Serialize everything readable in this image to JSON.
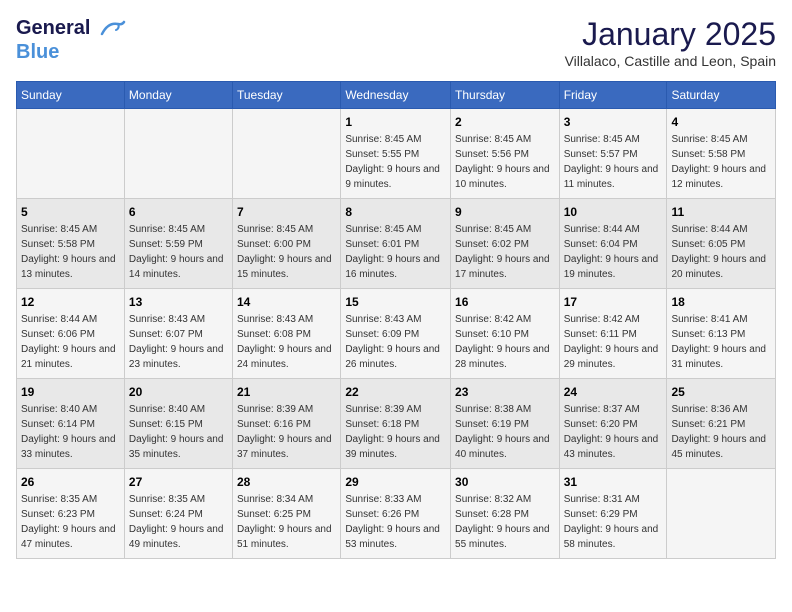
{
  "header": {
    "logo_line1": "General",
    "logo_line2": "Blue",
    "month": "January 2025",
    "location": "Villalaco, Castille and Leon, Spain"
  },
  "weekdays": [
    "Sunday",
    "Monday",
    "Tuesday",
    "Wednesday",
    "Thursday",
    "Friday",
    "Saturday"
  ],
  "weeks": [
    [
      {
        "day": "",
        "info": ""
      },
      {
        "day": "",
        "info": ""
      },
      {
        "day": "",
        "info": ""
      },
      {
        "day": "1",
        "info": "Sunrise: 8:45 AM\nSunset: 5:55 PM\nDaylight: 9 hours and 9 minutes."
      },
      {
        "day": "2",
        "info": "Sunrise: 8:45 AM\nSunset: 5:56 PM\nDaylight: 9 hours and 10 minutes."
      },
      {
        "day": "3",
        "info": "Sunrise: 8:45 AM\nSunset: 5:57 PM\nDaylight: 9 hours and 11 minutes."
      },
      {
        "day": "4",
        "info": "Sunrise: 8:45 AM\nSunset: 5:58 PM\nDaylight: 9 hours and 12 minutes."
      }
    ],
    [
      {
        "day": "5",
        "info": "Sunrise: 8:45 AM\nSunset: 5:58 PM\nDaylight: 9 hours and 13 minutes."
      },
      {
        "day": "6",
        "info": "Sunrise: 8:45 AM\nSunset: 5:59 PM\nDaylight: 9 hours and 14 minutes."
      },
      {
        "day": "7",
        "info": "Sunrise: 8:45 AM\nSunset: 6:00 PM\nDaylight: 9 hours and 15 minutes."
      },
      {
        "day": "8",
        "info": "Sunrise: 8:45 AM\nSunset: 6:01 PM\nDaylight: 9 hours and 16 minutes."
      },
      {
        "day": "9",
        "info": "Sunrise: 8:45 AM\nSunset: 6:02 PM\nDaylight: 9 hours and 17 minutes."
      },
      {
        "day": "10",
        "info": "Sunrise: 8:44 AM\nSunset: 6:04 PM\nDaylight: 9 hours and 19 minutes."
      },
      {
        "day": "11",
        "info": "Sunrise: 8:44 AM\nSunset: 6:05 PM\nDaylight: 9 hours and 20 minutes."
      }
    ],
    [
      {
        "day": "12",
        "info": "Sunrise: 8:44 AM\nSunset: 6:06 PM\nDaylight: 9 hours and 21 minutes."
      },
      {
        "day": "13",
        "info": "Sunrise: 8:43 AM\nSunset: 6:07 PM\nDaylight: 9 hours and 23 minutes."
      },
      {
        "day": "14",
        "info": "Sunrise: 8:43 AM\nSunset: 6:08 PM\nDaylight: 9 hours and 24 minutes."
      },
      {
        "day": "15",
        "info": "Sunrise: 8:43 AM\nSunset: 6:09 PM\nDaylight: 9 hours and 26 minutes."
      },
      {
        "day": "16",
        "info": "Sunrise: 8:42 AM\nSunset: 6:10 PM\nDaylight: 9 hours and 28 minutes."
      },
      {
        "day": "17",
        "info": "Sunrise: 8:42 AM\nSunset: 6:11 PM\nDaylight: 9 hours and 29 minutes."
      },
      {
        "day": "18",
        "info": "Sunrise: 8:41 AM\nSunset: 6:13 PM\nDaylight: 9 hours and 31 minutes."
      }
    ],
    [
      {
        "day": "19",
        "info": "Sunrise: 8:40 AM\nSunset: 6:14 PM\nDaylight: 9 hours and 33 minutes."
      },
      {
        "day": "20",
        "info": "Sunrise: 8:40 AM\nSunset: 6:15 PM\nDaylight: 9 hours and 35 minutes."
      },
      {
        "day": "21",
        "info": "Sunrise: 8:39 AM\nSunset: 6:16 PM\nDaylight: 9 hours and 37 minutes."
      },
      {
        "day": "22",
        "info": "Sunrise: 8:39 AM\nSunset: 6:18 PM\nDaylight: 9 hours and 39 minutes."
      },
      {
        "day": "23",
        "info": "Sunrise: 8:38 AM\nSunset: 6:19 PM\nDaylight: 9 hours and 40 minutes."
      },
      {
        "day": "24",
        "info": "Sunrise: 8:37 AM\nSunset: 6:20 PM\nDaylight: 9 hours and 43 minutes."
      },
      {
        "day": "25",
        "info": "Sunrise: 8:36 AM\nSunset: 6:21 PM\nDaylight: 9 hours and 45 minutes."
      }
    ],
    [
      {
        "day": "26",
        "info": "Sunrise: 8:35 AM\nSunset: 6:23 PM\nDaylight: 9 hours and 47 minutes."
      },
      {
        "day": "27",
        "info": "Sunrise: 8:35 AM\nSunset: 6:24 PM\nDaylight: 9 hours and 49 minutes."
      },
      {
        "day": "28",
        "info": "Sunrise: 8:34 AM\nSunset: 6:25 PM\nDaylight: 9 hours and 51 minutes."
      },
      {
        "day": "29",
        "info": "Sunrise: 8:33 AM\nSunset: 6:26 PM\nDaylight: 9 hours and 53 minutes."
      },
      {
        "day": "30",
        "info": "Sunrise: 8:32 AM\nSunset: 6:28 PM\nDaylight: 9 hours and 55 minutes."
      },
      {
        "day": "31",
        "info": "Sunrise: 8:31 AM\nSunset: 6:29 PM\nDaylight: 9 hours and 58 minutes."
      },
      {
        "day": "",
        "info": ""
      }
    ]
  ]
}
